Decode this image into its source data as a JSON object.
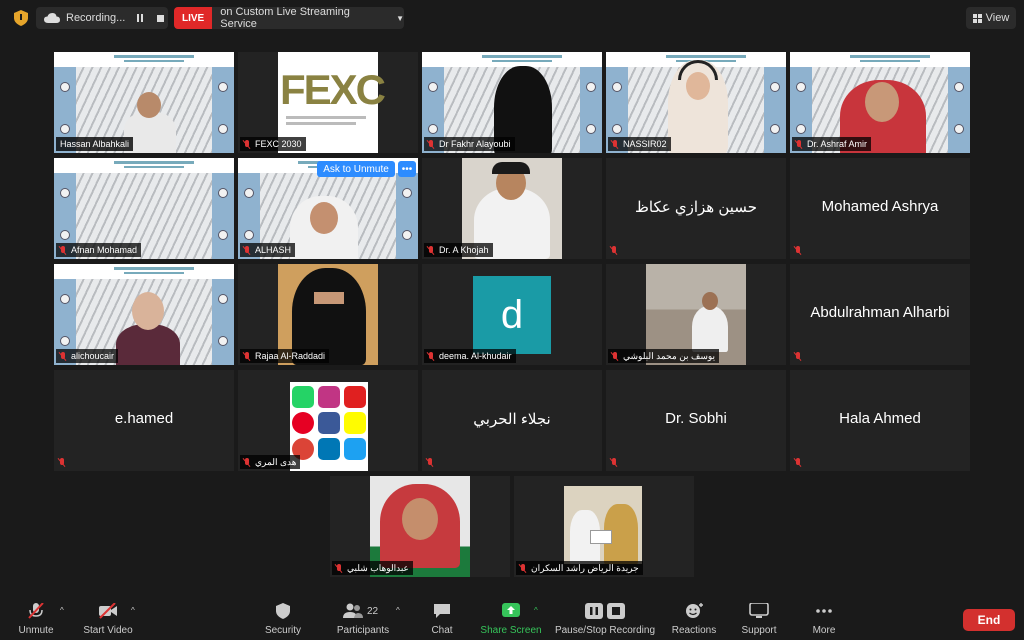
{
  "topbar": {
    "recording_label": "Recording...",
    "live_badge": "LIVE",
    "live_target": "on Custom Live Streaming Service",
    "view_label": "View"
  },
  "tiles": {
    "hassan": "Hassan  Albahkali",
    "fexc": "FEXC 2030",
    "fexc_logo": "FEXC",
    "fakhr": "Dr Fakhr Alayoubi",
    "nassir": "NASSIR02",
    "ashraf": "Dr. Ashraf Amir",
    "afnan": "Afnan Mohamad",
    "alhash": "ALHASH",
    "ask_unmute": "Ask to Unmute",
    "more": "•••",
    "khojah": "Dr. A Khojah",
    "hussein": "حسين هزازي عكاظ",
    "mohamed": "Mohamed Ashrya",
    "alichoucair": "alichoucair",
    "rajaa": "Rajaa Al-Raddadi",
    "deema": "deema. Al-khudair",
    "deema_initial": "d",
    "yousef": "يوسف بن محمد البلوشي",
    "abdulrahman": "Abdulrahman Alharbi",
    "ehamed": "e.hamed",
    "huda": "هدى المري",
    "najla": "نجلاء الحربي",
    "sobhi": "Dr. Sobhi",
    "hala": "Hala Ahmed",
    "abdulwahab": "عبدالوهاب شلبي",
    "riyadh": "جريدة الرياض راشد السكران"
  },
  "toolbar": {
    "unmute": "Unmute",
    "start_video": "Start Video",
    "security": "Security",
    "participants": "Participants",
    "participants_count": "22",
    "chat": "Chat",
    "share_screen": "Share Screen",
    "pause_stop": "Pause/Stop Recording",
    "reactions": "Reactions",
    "support": "Support",
    "more": "More",
    "end": "End"
  },
  "colors": {
    "live_red": "#e02828",
    "share_green": "#36c45a",
    "active_speaker": "#e7e77a",
    "ask_unmute_blue": "#2d8cff",
    "end_red": "#d3302e",
    "deema_teal": "#1a9ba6"
  }
}
